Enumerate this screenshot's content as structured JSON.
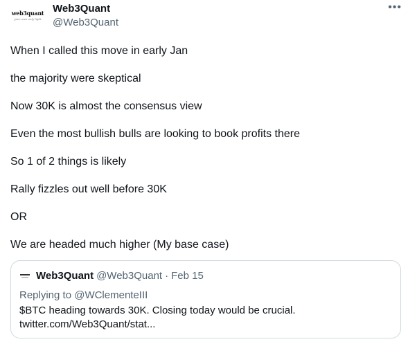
{
  "author": {
    "display_name": "Web3Quant",
    "handle": "@Web3Quant",
    "avatar_logo_text": "web3quant",
    "avatar_tagline": "your own only light"
  },
  "more_icon": "more-horizontal-icon",
  "tweet_lines": [
    "When I called this move in early Jan",
    "the majority were skeptical",
    "Now 30K is almost the consensus view",
    "Even the most bullish bulls are looking to book profits there",
    "So 1 of 2 things is likely",
    "Rally fizzles out well before 30K",
    "OR",
    "We are headed much higher (My base case)"
  ],
  "quoted_tweet": {
    "display_name": "Web3Quant",
    "handle": "@Web3Quant",
    "separator": "·",
    "date": "Feb 15",
    "replying_prefix": "Replying to ",
    "replying_to": "@WClementeIII",
    "text_line1": "$BTC heading towards 30K. Closing today would be crucial.",
    "text_line2": "twitter.com/Web3Quant/stat..."
  },
  "colors": {
    "text": "#0f1419",
    "secondary": "#536471",
    "border": "#cfd9de"
  }
}
